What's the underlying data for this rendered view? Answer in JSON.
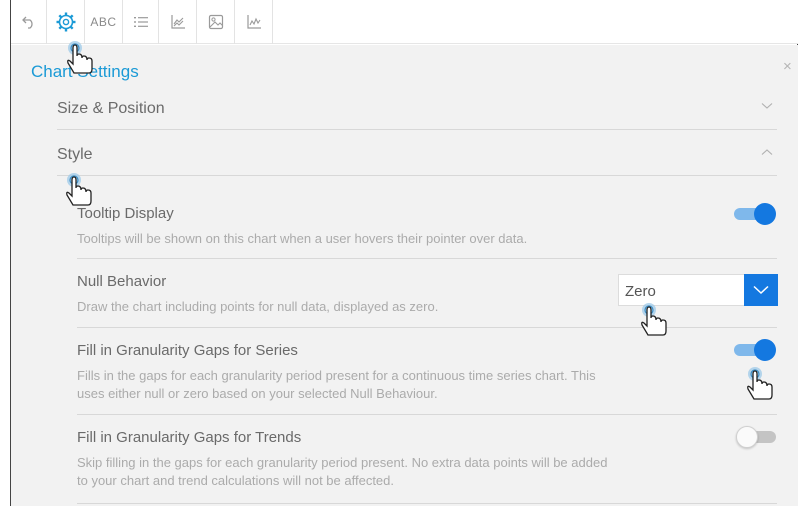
{
  "toolbar": {
    "items": [
      {
        "name": "undo-icon"
      },
      {
        "name": "gear-icon"
      },
      {
        "name": "abc-text-icon",
        "label": "ABC"
      },
      {
        "name": "list-icon"
      },
      {
        "name": "axis-chart-icon"
      },
      {
        "name": "image-icon"
      },
      {
        "name": "line-chart-icon"
      }
    ],
    "active_color": "#1b9ad6"
  },
  "panel": {
    "title": "Chart Settings",
    "close_label": "×",
    "sections": [
      {
        "label": "Size & Position",
        "expanded": false
      },
      {
        "label": "Style",
        "expanded": true
      }
    ]
  },
  "settings": {
    "tooltip": {
      "name": "Tooltip Display",
      "description": "Tooltips will be shown on this chart when a user hovers their pointer over data.",
      "enabled": true
    },
    "null_behavior": {
      "name": "Null Behavior",
      "description": "Draw the chart including points for null data, displayed as zero.",
      "selected": "Zero"
    },
    "gaps_series": {
      "name": "Fill in Granularity Gaps for Series",
      "description_lines": [
        "Fills in the gaps for each granularity period present for a continuous time series chart. This",
        "uses either null or zero based on your selected Null Behaviour."
      ],
      "enabled": true
    },
    "gaps_trends": {
      "name": "Fill in Granularity Gaps for Trends",
      "description_lines": [
        "Skip filling in the gaps for each granularity period present. No extra data points will be added",
        "to your chart and trend calculations will not be affected."
      ],
      "enabled": false
    }
  },
  "colors": {
    "accent": "#1478e0",
    "title": "#1b9ad6",
    "toggle_on_track": "#7fb8eb"
  }
}
